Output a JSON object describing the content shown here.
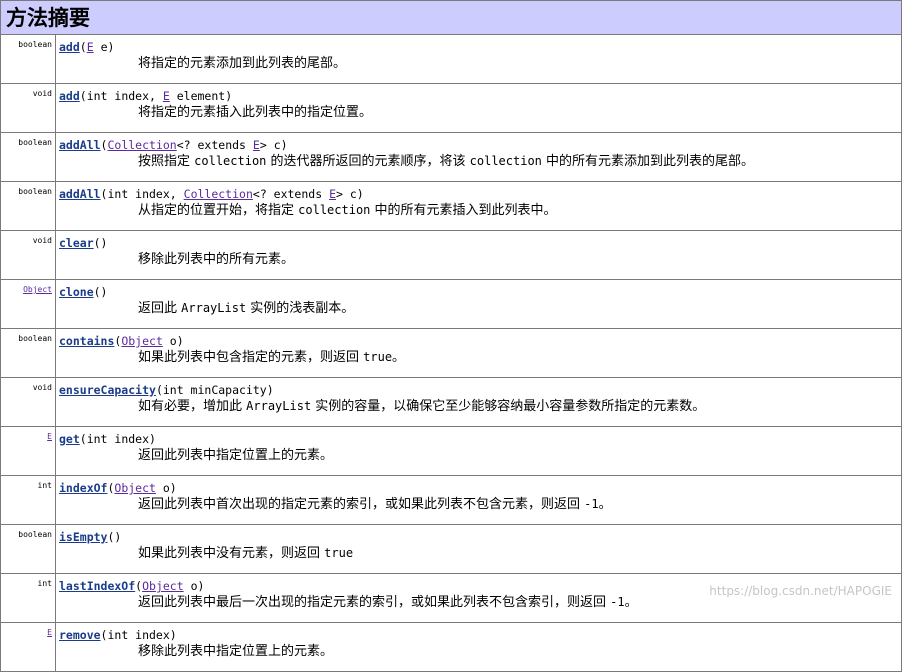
{
  "header": {
    "title": "方法摘要"
  },
  "methods": [
    {
      "type": "boolean",
      "name": "add",
      "params": [
        {
          "text": "("
        },
        {
          "text": "E",
          "link": true
        },
        {
          "text": " e)"
        }
      ],
      "desc": [
        {
          "text": "将指定的元素添加到此列表的尾部。"
        }
      ]
    },
    {
      "type": "void",
      "name": "add",
      "params": [
        {
          "text": "(int index, "
        },
        {
          "text": "E",
          "link": true
        },
        {
          "text": " element)"
        }
      ],
      "desc": [
        {
          "text": "将指定的元素插入此列表中的指定位置。"
        }
      ]
    },
    {
      "type": "boolean",
      "name": "addAll",
      "params": [
        {
          "text": "("
        },
        {
          "text": "Collection",
          "link": true
        },
        {
          "text": "<? extends "
        },
        {
          "text": "E",
          "link": true
        },
        {
          "text": "> c)"
        }
      ],
      "desc": [
        {
          "text": "按照指定 "
        },
        {
          "text": "collection",
          "code": true
        },
        {
          "text": " 的迭代器所返回的元素顺序，将该 "
        },
        {
          "text": "collection",
          "code": true
        },
        {
          "text": " 中的所有元素添加到此列表的尾部。"
        }
      ]
    },
    {
      "type": "boolean",
      "name": "addAll",
      "params": [
        {
          "text": "(int index, "
        },
        {
          "text": "Collection",
          "link": true
        },
        {
          "text": "<? extends "
        },
        {
          "text": "E",
          "link": true
        },
        {
          "text": "> c)"
        }
      ],
      "desc": [
        {
          "text": "从指定的位置开始，将指定 "
        },
        {
          "text": "collection",
          "code": true
        },
        {
          "text": " 中的所有元素插入到此列表中。"
        }
      ]
    },
    {
      "type": "void",
      "name": "clear",
      "params": [
        {
          "text": "()"
        }
      ],
      "desc": [
        {
          "text": "移除此列表中的所有元素。"
        }
      ]
    },
    {
      "type": "Object",
      "type_link": true,
      "name": "clone",
      "params": [
        {
          "text": "()"
        }
      ],
      "desc": [
        {
          "text": "返回此 "
        },
        {
          "text": "ArrayList",
          "code": true
        },
        {
          "text": " 实例的浅表副本。"
        }
      ]
    },
    {
      "type": "boolean",
      "name": "contains",
      "params": [
        {
          "text": "("
        },
        {
          "text": "Object",
          "link": true
        },
        {
          "text": " o)"
        }
      ],
      "desc": [
        {
          "text": "如果此列表中包含指定的元素，则返回 "
        },
        {
          "text": "true",
          "code": true
        },
        {
          "text": "。"
        }
      ]
    },
    {
      "type": "void",
      "name": "ensureCapacity",
      "params": [
        {
          "text": "(int minCapacity)"
        }
      ],
      "desc": [
        {
          "text": "如有必要，增加此 "
        },
        {
          "text": "ArrayList",
          "code": true
        },
        {
          "text": " 实例的容量，以确保它至少能够容纳最小容量参数所指定的元素数。"
        }
      ]
    },
    {
      "type": "E",
      "type_link": true,
      "name": "get",
      "params": [
        {
          "text": "(int index)"
        }
      ],
      "desc": [
        {
          "text": "返回此列表中指定位置上的元素。"
        }
      ]
    },
    {
      "type": "int",
      "name": "indexOf",
      "params": [
        {
          "text": "("
        },
        {
          "text": "Object",
          "link": true
        },
        {
          "text": " o)"
        }
      ],
      "desc": [
        {
          "text": "返回此列表中首次出现的指定元素的索引，或如果此列表不包含元素，则返回 "
        },
        {
          "text": "-1",
          "code": true
        },
        {
          "text": "。"
        }
      ]
    },
    {
      "type": "boolean",
      "name": "isEmpty",
      "params": [
        {
          "text": "()"
        }
      ],
      "desc": [
        {
          "text": "如果此列表中没有元素，则返回 "
        },
        {
          "text": "true",
          "code": true
        }
      ]
    },
    {
      "type": "int",
      "name": "lastIndexOf",
      "params": [
        {
          "text": "("
        },
        {
          "text": "Object",
          "link": true
        },
        {
          "text": " o)"
        }
      ],
      "desc": [
        {
          "text": "返回此列表中最后一次出现的指定元素的索引，或如果此列表不包含索引，则返回 "
        },
        {
          "text": "-1",
          "code": true
        },
        {
          "text": "。"
        }
      ]
    },
    {
      "type": "E",
      "type_link": true,
      "name": "remove",
      "params": [
        {
          "text": "(int index)"
        }
      ],
      "desc": [
        {
          "text": "移除此列表中指定位置上的元素。"
        }
      ]
    }
  ],
  "watermark": "https://blog.csdn.net/HAPOGIE"
}
